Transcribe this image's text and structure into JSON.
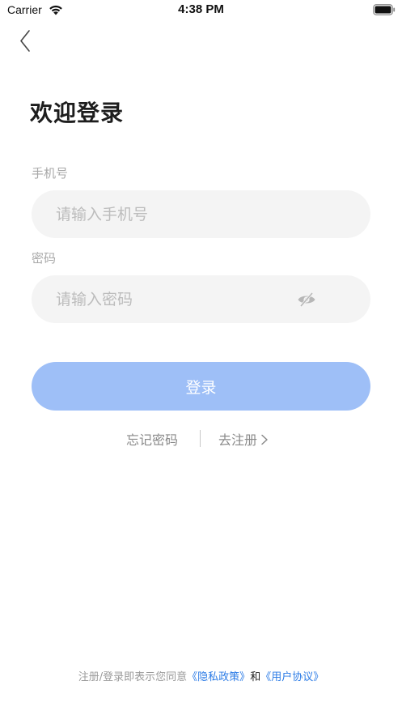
{
  "status_bar": {
    "carrier": "Carrier",
    "time": "4:38 PM"
  },
  "page": {
    "title": "欢迎登录"
  },
  "phone": {
    "label": "手机号",
    "placeholder": "请输入手机号",
    "value": ""
  },
  "password": {
    "label": "密码",
    "placeholder": "请输入密码",
    "value": ""
  },
  "login_button": "登录",
  "links": {
    "forgot": "忘记密码",
    "register": "去注册"
  },
  "agreement": {
    "prefix": "注册/登录即表示您同意",
    "privacy": "《隐私政策》",
    "and": "和",
    "terms": "《用户协议》"
  },
  "colors": {
    "accent": "#9ebff7",
    "link": "#2b7be6",
    "input_bg": "#f4f4f4"
  },
  "icons": [
    "back-chevron-icon",
    "wifi-icon",
    "battery-icon",
    "eye-hidden-icon",
    "chevron-right-icon"
  ]
}
